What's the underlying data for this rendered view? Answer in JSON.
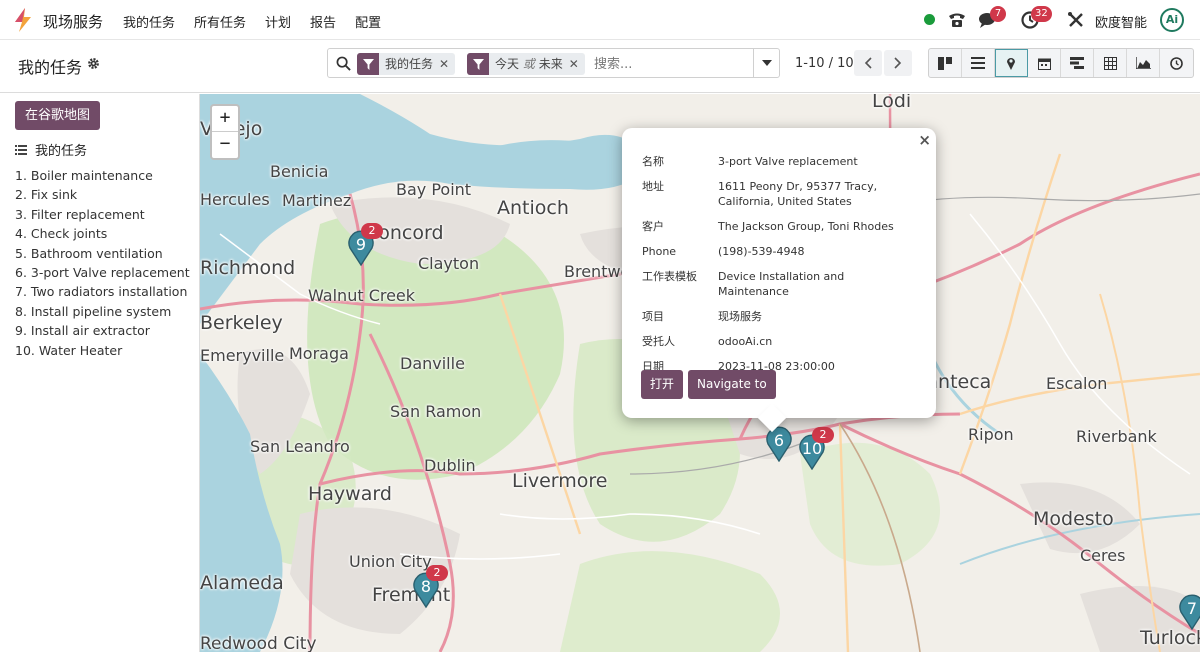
{
  "app": {
    "name": "现场服务",
    "menu": [
      "我的任务",
      "所有任务",
      "计划",
      "报告",
      "配置"
    ],
    "company": "欧度智能",
    "avatar": "Ai",
    "badges": {
      "messages": "7",
      "activities": "32"
    }
  },
  "control": {
    "title": "我的任务",
    "facets": [
      {
        "label": "我的任务"
      },
      {
        "label_a": "今天",
        "label_or": "或",
        "label_b": "未来"
      }
    ],
    "search_placeholder": "搜索...",
    "pager": "1-10 / 10",
    "views": [
      "kanban-icon",
      "list-icon",
      "map-icon",
      "calendar-icon",
      "gantt-icon",
      "pivot-icon",
      "graph-icon",
      "activity-icon"
    ],
    "active_view": "map"
  },
  "sidebar": {
    "google_maps_button": "在谷歌地图",
    "list_title": "我的任务",
    "tasks": [
      "1. Boiler maintenance",
      "2. Fix sink",
      "3. Filter replacement",
      "4. Check joints",
      "5. Bathroom ventilation",
      "6. 3-port Valve replacement",
      "7. Two radiators installation",
      "8. Install pipeline system",
      "9. Install air extractor",
      "10. Water Heater"
    ]
  },
  "map": {
    "zoom_in": "+",
    "zoom_out": "−",
    "places": [
      "Lodi",
      "Vallejo",
      "Benicia",
      "Hercules",
      "Martinez",
      "Bay Point",
      "Antioch",
      "Concord",
      "Clayton",
      "Brentwood",
      "Richmond",
      "Walnut Creek",
      "Berkeley",
      "Emeryville",
      "Moraga",
      "Danville",
      "San Ramon",
      "San Leandro",
      "Dublin",
      "Livermore",
      "Hayward",
      "Union City",
      "Fremont",
      "Alameda",
      "Redwood City",
      "Manteca",
      "Escalon",
      "Ripon",
      "Riverbank",
      "Modesto",
      "Ceres",
      "Turlock"
    ],
    "markers": [
      {
        "number": "9",
        "count": "2"
      },
      {
        "number": "6",
        "count": ""
      },
      {
        "number": "10",
        "count": "2"
      },
      {
        "number": "8",
        "count": "2"
      },
      {
        "number": "7",
        "count": ""
      }
    ]
  },
  "popup": {
    "fields": [
      {
        "key": "名称",
        "value": "3-port Valve replacement"
      },
      {
        "key": "地址",
        "value": "1611 Peony Dr, 95377 Tracy, California, United States"
      },
      {
        "key": "客户",
        "value": "The Jackson Group, Toni Rhodes"
      },
      {
        "key": "Phone",
        "value": "(198)-539-4948"
      },
      {
        "key": "工作表模板",
        "value": "Device Installation and Maintenance"
      },
      {
        "key": "项目",
        "value": "现场服务"
      },
      {
        "key": "受托人",
        "value": "odooAi.cn"
      },
      {
        "key": "日期",
        "value": "2023-11-08 23:00:00"
      }
    ],
    "open_button": "打开",
    "navigate_button": "Navigate to",
    "close": "×"
  },
  "colors": {
    "primary": "#714b67",
    "marker": "#3d8a9e",
    "badge": "#d0384a",
    "online": "#1a9b3b"
  }
}
